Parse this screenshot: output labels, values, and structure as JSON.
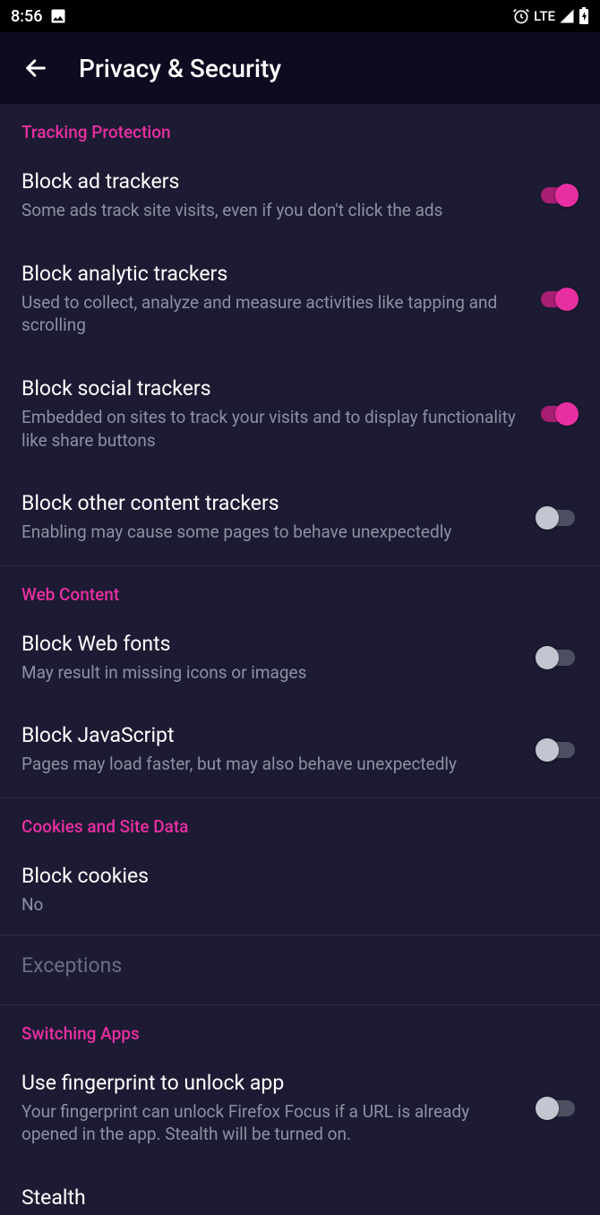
{
  "status": {
    "time": "8:56",
    "network": "LTE"
  },
  "header": {
    "title": "Privacy & Security"
  },
  "sections": {
    "tracking": {
      "header": "Tracking Protection",
      "block_ad_trackers": {
        "title": "Block ad trackers",
        "sub": "Some ads track site visits, even if you don't click the ads",
        "on": true
      },
      "block_analytic_trackers": {
        "title": "Block analytic trackers",
        "sub": "Used to collect, analyze and measure activities like tapping and scrolling",
        "on": true
      },
      "block_social_trackers": {
        "title": "Block social trackers",
        "sub": "Embedded on sites to track your visits and to display functionality like share buttons",
        "on": true
      },
      "block_other_trackers": {
        "title": "Block other content trackers",
        "sub": "Enabling may cause some pages to behave unexpectedly",
        "on": false
      }
    },
    "web_content": {
      "header": "Web Content",
      "block_web_fonts": {
        "title": "Block Web fonts",
        "sub": "May result in missing icons or images",
        "on": false
      },
      "block_javascript": {
        "title": "Block JavaScript",
        "sub": "Pages may load faster, but may also behave unexpectedly",
        "on": false
      }
    },
    "cookies": {
      "header": "Cookies and Site Data",
      "block_cookies": {
        "title": "Block cookies",
        "sub": "No"
      },
      "exceptions": {
        "title": "Exceptions"
      }
    },
    "switching_apps": {
      "header": "Switching Apps",
      "fingerprint": {
        "title": "Use fingerprint to unlock app",
        "sub": "Your fingerprint can unlock Firefox Focus if a URL is already opened in the app. Stealth will be turned on.",
        "on": false
      },
      "stealth": {
        "title": "Stealth"
      }
    }
  }
}
